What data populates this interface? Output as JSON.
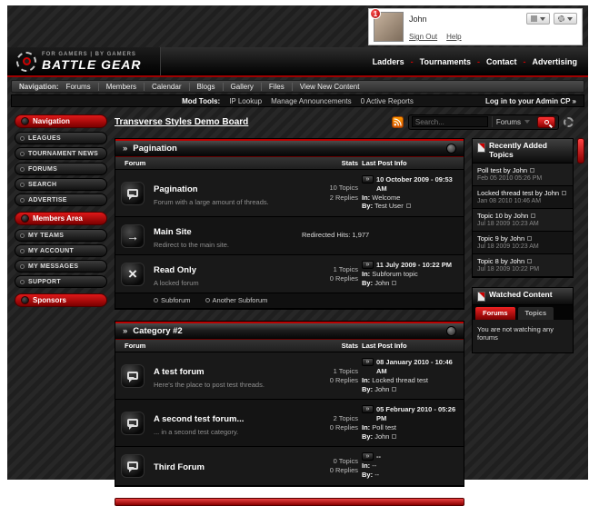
{
  "accent": {
    "red": "#cc0000"
  },
  "user_panel": {
    "username": "John",
    "badge": "1",
    "sign_out": "Sign Out",
    "help": "Help"
  },
  "header": {
    "tagline": "FOR GAMERS | BY GAMERS",
    "brand": "BATTLE GEAR",
    "nav": [
      "Ladders",
      "Tournaments",
      "Contact",
      "Advertising"
    ]
  },
  "navbar": {
    "label": "Navigation:",
    "items": [
      "Forums",
      "Members",
      "Calendar",
      "Blogs",
      "Gallery",
      "Files",
      "View New Content"
    ]
  },
  "modbar": {
    "label": "Mod Tools:",
    "items": [
      "IP Lookup",
      "Manage Announcements",
      "0 Active Reports"
    ],
    "admin_link": "Log in to your Admin CP »"
  },
  "sidebar": {
    "sections": [
      {
        "title": "Navigation",
        "items": [
          "LEAGUES",
          "TOURNAMENT NEWS",
          "FORUMS",
          "SEARCH",
          "ADVERTISE"
        ]
      },
      {
        "title": "Members Area",
        "items": [
          "MY TEAMS",
          "MY ACCOUNT",
          "MY MESSAGES",
          "SUPPORT"
        ]
      },
      {
        "title": "Sponsors",
        "items": []
      }
    ]
  },
  "content": {
    "breadcrumb": "Transverse Styles Demo Board",
    "search_placeholder": "Search...",
    "search_scope": "Forums"
  },
  "labels": {
    "in": "In:",
    "by": "By:",
    "go": "»"
  },
  "categories": [
    {
      "title": "Pagination",
      "chev": "»",
      "columns": [
        "Forum",
        "Stats",
        "Last Post Info"
      ],
      "rows": [
        {
          "name": "Pagination",
          "desc": "Forum with a large amount of threads.",
          "topics": "10 Topics",
          "replies": "2 Replies",
          "date": "10 October 2009 - 09:53 AM",
          "in": "Welcome",
          "by": "Test User"
        },
        {
          "name": "Main Site",
          "desc": "Redirect to the main site.",
          "stats_text": "Redirected Hits: 1,977"
        },
        {
          "name": "Read Only",
          "desc": "A locked forum",
          "topics": "1 Topics",
          "replies": "0 Replies",
          "date": "11 July 2009 - 10:22 PM",
          "in": "Subforum topic",
          "by": "John",
          "subforums": [
            "Subforum",
            "Another Subforum"
          ]
        }
      ]
    },
    {
      "title": "Category #2",
      "chev": "»",
      "columns": [
        "Forum",
        "Stats",
        "Last Post Info"
      ],
      "rows": [
        {
          "name": "A test forum",
          "desc": "Here's the place to post test threads.",
          "topics": "1 Topics",
          "replies": "0 Replies",
          "date": "08 January 2010 - 10:46 AM",
          "in": "Locked thread test",
          "by": "John"
        },
        {
          "name": "A second test forum...",
          "desc": "... in a second test category.",
          "topics": "2 Topics",
          "replies": "0 Replies",
          "date": "05 February 2010 - 05:26 PM",
          "in": "Poll test",
          "by": "John"
        },
        {
          "name": "Third Forum",
          "desc": "",
          "topics": "0 Topics",
          "replies": "0 Replies",
          "date": "--",
          "in": "--",
          "by": "--"
        }
      ]
    }
  ],
  "recent_topics": {
    "title": "Recently Added Topics",
    "items": [
      {
        "title": "Poll test by John",
        "date": "Feb 05 2010 05:26 PM"
      },
      {
        "title": "Locked thread test by John",
        "date": "Jan 08 2010 10:46 AM"
      },
      {
        "title": "Topic 10 by John",
        "date": "Jul 18 2009 10:23 AM"
      },
      {
        "title": "Topic 9 by John",
        "date": "Jul 18 2009 10:23 AM"
      },
      {
        "title": "Topic 8 by John",
        "date": "Jul 18 2009 10:22 PM"
      }
    ]
  },
  "watched": {
    "title": "Watched Content",
    "tabs": [
      "Forums",
      "Topics"
    ],
    "empty": "You are not watching any forums"
  }
}
